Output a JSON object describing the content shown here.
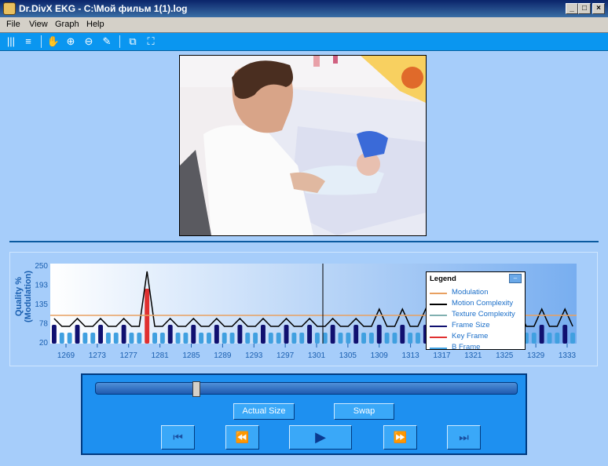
{
  "window": {
    "title": "Dr.DivX EKG - C:\\Мой фильм 1(1).log",
    "min": "_",
    "max": "□",
    "close": "×"
  },
  "menu": [
    "File",
    "View",
    "Graph",
    "Help"
  ],
  "toolbar": {
    "icons": [
      "vertical-lines-icon",
      "horizontal-lines-icon",
      "hand-icon",
      "zoom-in-icon",
      "zoom-out-icon",
      "edit-icon",
      "window-icon",
      "fit-icon"
    ],
    "glyphs": [
      "|||",
      "≡",
      "✋",
      "⊕",
      "⊖",
      "✎",
      "⧉",
      "⛶"
    ]
  },
  "graph": {
    "ylabel_line1": "Quality %",
    "ylabel_line2": "(Modulation)",
    "yticks": [
      "250",
      "193",
      "135",
      "78",
      "20"
    ],
    "xticks": [
      "1269",
      "1273",
      "1277",
      "1281",
      "1285",
      "1289",
      "1293",
      "1297",
      "1301",
      "1305",
      "1309",
      "1313",
      "1317",
      "1321",
      "1325",
      "1329",
      "1333"
    ],
    "legend_title": "Legend",
    "legend_close": "–",
    "legend": [
      {
        "label": "Modulation",
        "color": "#e8a060"
      },
      {
        "label": "Motion Complexity",
        "color": "#000000"
      },
      {
        "label": "Texture Complexity",
        "color": "#80b0b0"
      },
      {
        "label": "Frame Size",
        "color": "#101070"
      },
      {
        "label": "Key Frame",
        "color": "#e03030"
      },
      {
        "label": "B Frame",
        "color": "#40a0e0"
      }
    ]
  },
  "controls": {
    "actual_size": "Actual Size",
    "swap": "Swap",
    "buttons": [
      "⏮",
      "⏪",
      "▶",
      "⏩",
      "⏭"
    ],
    "slider_position": 0.24
  }
}
